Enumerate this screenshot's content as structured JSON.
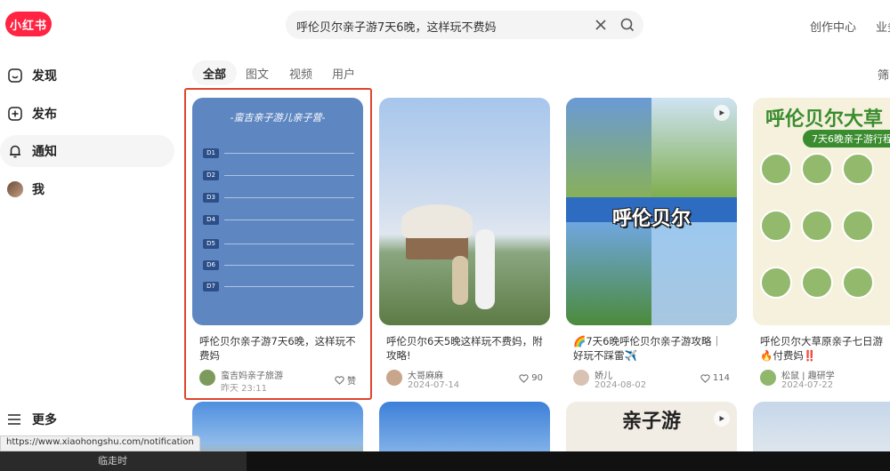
{
  "header": {
    "logo": "小红书",
    "search_value": "呼伦贝尔亲子游7天6晚，这样玩不费妈",
    "links": [
      "创作中心",
      "业务"
    ]
  },
  "sidebar": {
    "items": [
      {
        "label": "发现",
        "icon": "discover-icon",
        "active": false
      },
      {
        "label": "发布",
        "icon": "publish-icon",
        "active": false
      },
      {
        "label": "通知",
        "icon": "bell-icon",
        "active": true
      },
      {
        "label": "我",
        "icon": "avatar",
        "active": false
      }
    ],
    "more": "更多"
  },
  "tabs": [
    "全部",
    "图文",
    "视频",
    "用户"
  ],
  "filter_label": "筛",
  "cards": [
    {
      "image_title": "-蛮吉亲子游儿亲子营-",
      "title": "呼伦贝尔亲子游7天6晚，这样玩不费妈",
      "author": "蛮吉妈亲子旅游",
      "date": "昨天 23:11",
      "likes": "赞"
    },
    {
      "title": "呼伦贝尔6天5晚这样玩不费妈，附攻略!",
      "author": "大哥麻麻",
      "date": "2024-07-14",
      "likes": "90"
    },
    {
      "image_text": "呼伦贝尔",
      "title": "🌈7天6晚呼伦贝尔亲子游攻略｜好玩不踩雷✈️",
      "author": "娇儿",
      "date": "2024-08-02",
      "likes": "114"
    },
    {
      "image_title": "呼伦贝尔大草",
      "image_sub": "7天6晚亲子游行程",
      "title": "呼伦贝尔大草原亲子七日游🔥付费妈‼️",
      "author": "松鼠 | 趣研学",
      "date": "2024-07-22",
      "likes": ""
    }
  ],
  "bottom_cards": [
    {
      "image_text": ""
    },
    {
      "image_text": ""
    },
    {
      "image_text": "亲子游"
    },
    {
      "image_text": ""
    }
  ],
  "status_url": "https://www.xiaohongshu.com/notification",
  "bottom_bar_text": "临走时",
  "colors": {
    "brand": "#ff2442",
    "selection": "#e0442c"
  }
}
